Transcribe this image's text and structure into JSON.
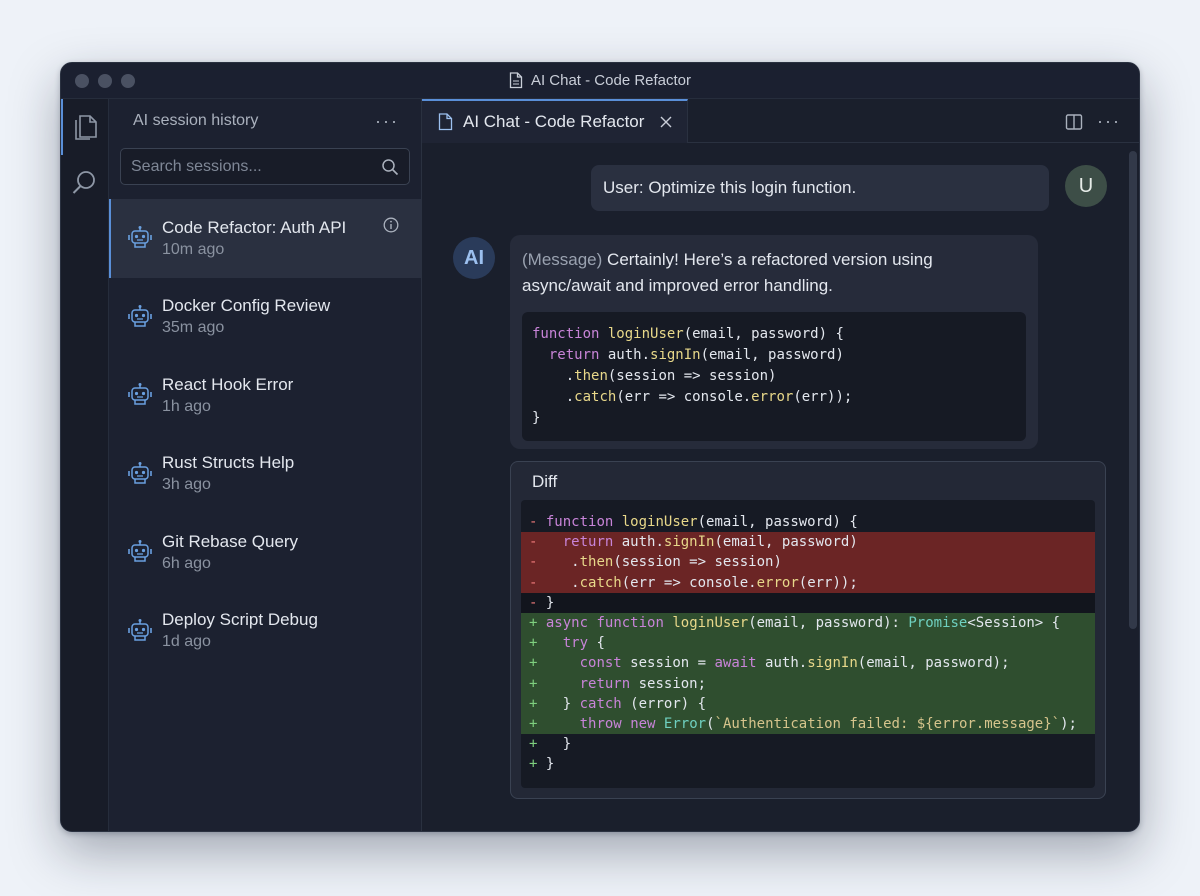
{
  "window": {
    "title": "AI Chat - Code Refactor"
  },
  "sidebar": {
    "title": "AI session history",
    "search_placeholder": "Search sessions...",
    "sessions": [
      {
        "title": "Code Refactor: Auth API",
        "time": "10m ago",
        "active": true
      },
      {
        "title": "Docker Config Review",
        "time": "35m ago"
      },
      {
        "title": "React Hook Error",
        "time": "1h ago"
      },
      {
        "title": "Rust Structs Help",
        "time": "3h ago"
      },
      {
        "title": "Git Rebase Query",
        "time": "6h ago"
      },
      {
        "title": "Deploy Script Debug",
        "time": "1d ago"
      }
    ]
  },
  "editor": {
    "tab_label": "AI Chat - Code Refactor",
    "user_message": "User: Optimize this login function.",
    "user_avatar": "U",
    "ai_avatar": "AI",
    "ai_message_prefix": "(Message)",
    "ai_message_text": "Certainly! Here’s a refactored version using async/await and improved error handling.",
    "code_lines": [
      "function loginUser(email, password) {",
      "  return auth.signIn(email, password)",
      "    .then(session => session)",
      "    .catch(err => console.error(err));",
      "}"
    ],
    "diff_title": "Diff",
    "diff_lines": [
      {
        "type": "ctx",
        "sign": "-",
        "text": "function loginUser(email, password) {"
      },
      {
        "type": "del",
        "sign": "-",
        "text": "  return auth.signIn(email, password)"
      },
      {
        "type": "del",
        "sign": "-",
        "text": "   .then(session => session)"
      },
      {
        "type": "del",
        "sign": "-",
        "text": "   .catch(err => console.error(err));"
      },
      {
        "type": "sep",
        "sign": "-",
        "text": "}"
      },
      {
        "type": "add",
        "sign": "+",
        "text": "async function loginUser(email, password): Promise<Session> {"
      },
      {
        "type": "add",
        "sign": "+",
        "text": "  try {"
      },
      {
        "type": "add",
        "sign": "+",
        "text": "    const session = await auth.signIn(email, password);"
      },
      {
        "type": "add",
        "sign": "+",
        "text": "    return session;"
      },
      {
        "type": "add",
        "sign": "+",
        "text": "  } catch (error) {"
      },
      {
        "type": "add",
        "sign": "+",
        "text": "    throw new Error(`Authentication failed: ${error.message}`);"
      },
      {
        "type": "ctx",
        "sign": "+",
        "text": "  }"
      },
      {
        "type": "ctx",
        "sign": "+",
        "text": "}"
      }
    ]
  },
  "colors": {
    "accent": "#5a8fd8",
    "diff_removed": "#6b2525",
    "diff_added": "#2f4e2f"
  },
  "icons": {
    "activity_explorer": "files-icon",
    "activity_search": "search-icon",
    "session_item": "robot-icon",
    "session_info": "info-icon",
    "tab_file": "file-icon",
    "tab_close": "close-icon",
    "split_editor": "split-editor-icon",
    "more": "ellipsis-icon"
  }
}
